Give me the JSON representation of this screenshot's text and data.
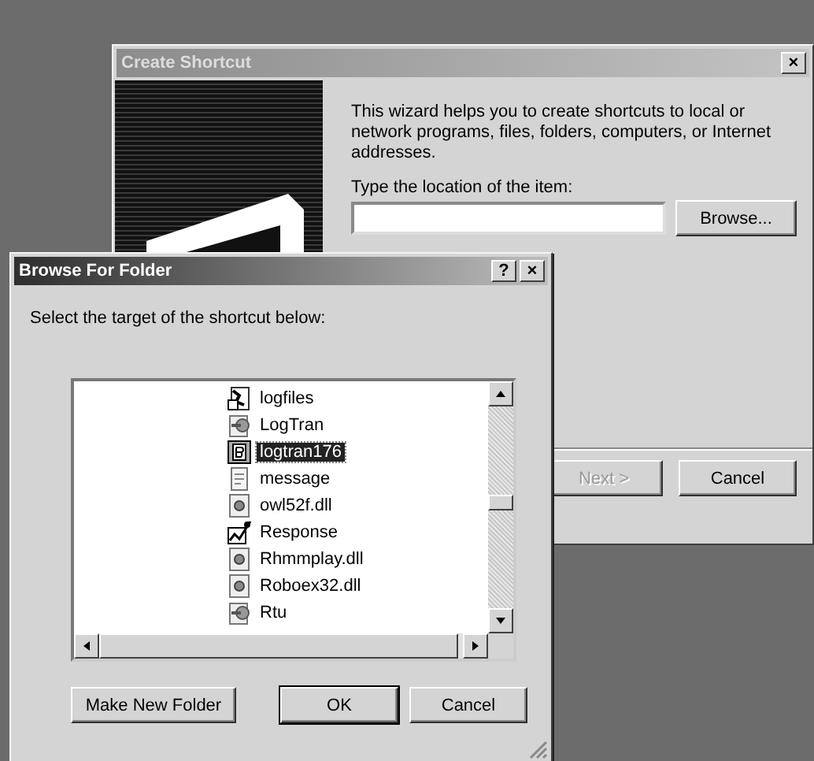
{
  "wizard": {
    "title": "Create Shortcut",
    "intro": "This wizard helps you to create shortcuts to local or network programs, files, folders, computers, or Internet addresses.",
    "location_label": "Type the location of the item:",
    "browse_button": "Browse...",
    "next_button": {
      "label": "Next >",
      "disabled": true
    },
    "cancel_button": "Cancel"
  },
  "browse_dialog": {
    "title": "Browse For Folder",
    "help_button": "?",
    "close_button": "×",
    "instruction": "Select the target of the shortcut below:",
    "items": [
      {
        "name": "logfiles",
        "kind": "shortcut",
        "selected": false
      },
      {
        "name": "LogTran",
        "kind": "application",
        "selected": false
      },
      {
        "name": "logtran176",
        "kind": "binary",
        "selected": true
      },
      {
        "name": "message",
        "kind": "document",
        "selected": false
      },
      {
        "name": "owl52f.dll",
        "kind": "library",
        "selected": false
      },
      {
        "name": "Response",
        "kind": "chart",
        "selected": false
      },
      {
        "name": "Rhmmplay.dll",
        "kind": "library",
        "selected": false
      },
      {
        "name": "Roboex32.dll",
        "kind": "library",
        "selected": false
      },
      {
        "name": "Rtu",
        "kind": "application",
        "selected": false
      }
    ],
    "buttons": [
      "Make New Folder",
      "OK",
      "Cancel"
    ]
  },
  "wizard_close": "×"
}
